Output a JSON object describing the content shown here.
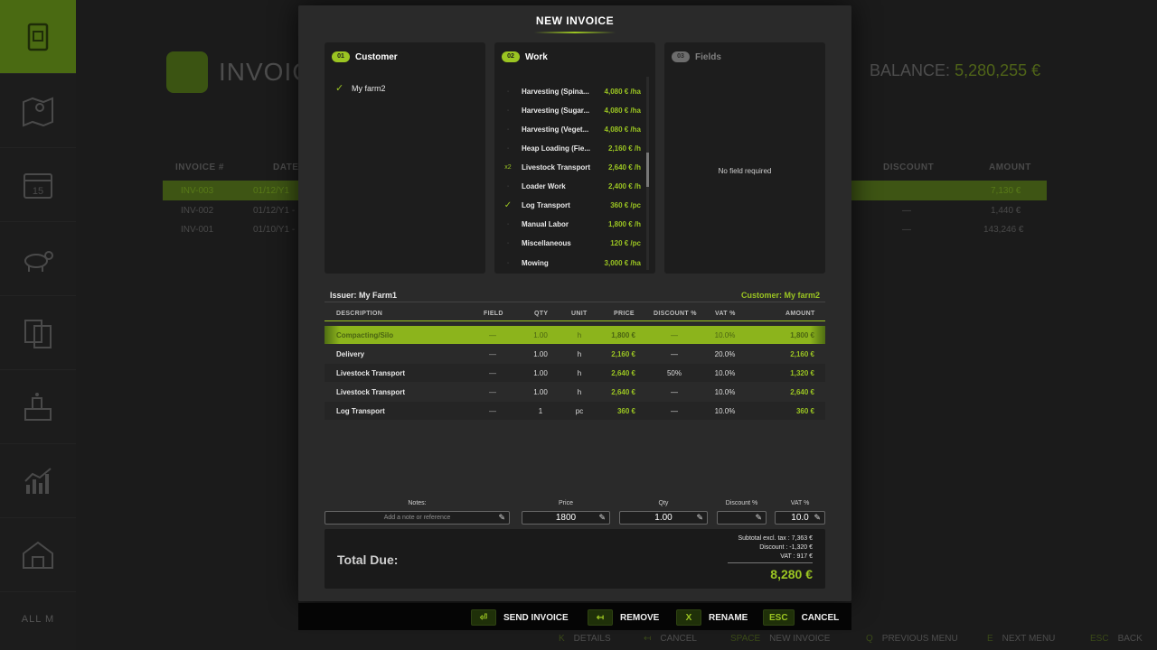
{
  "background": {
    "title": "INVOIC",
    "balance_label": "BALANCE:",
    "balance_value": "5,280,255 €",
    "columns": [
      "INVOICE #",
      "DATE",
      "DISCOUNT",
      "AMOUNT"
    ],
    "rows": [
      {
        "id": "INV-003",
        "date": "01/12/Y1",
        "discount": "",
        "amount": "7,130 €"
      },
      {
        "id": "INV-002",
        "date": "01/12/Y1 -",
        "discount": "—",
        "amount": "1,440 €"
      },
      {
        "id": "INV-001",
        "date": "01/10/Y1 -",
        "discount": "—",
        "amount": "143,246 €"
      }
    ]
  },
  "sidebar": {
    "items": [
      "invoice-icon",
      "map-icon",
      "calendar-icon",
      "animals-icon",
      "documents-icon",
      "production-icon",
      "statistics-icon",
      "farm-icon"
    ],
    "calendar_day": "15",
    "footer": "ALL M"
  },
  "modal": {
    "title": "NEW INVOICE",
    "panels": {
      "customer": {
        "step": "01",
        "title": "Customer",
        "items": [
          "My farm2"
        ]
      },
      "work": {
        "step": "02",
        "title": "Work",
        "items": [
          {
            "marker": "·",
            "name": "Harvesting (Spina...",
            "price": "4,080 € /ha"
          },
          {
            "marker": "·",
            "name": "Harvesting (Sugar...",
            "price": "4,080 € /ha"
          },
          {
            "marker": "·",
            "name": "Harvesting (Veget...",
            "price": "4,080 € /ha"
          },
          {
            "marker": "·",
            "name": "Heap Loading (Fie...",
            "price": "2,160 € /h"
          },
          {
            "marker": "x2",
            "name": "Livestock Transport",
            "price": "2,640 € /h"
          },
          {
            "marker": "·",
            "name": "Loader Work",
            "price": "2,400 € /h"
          },
          {
            "marker": "✓",
            "name": "Log Transport",
            "price": "360 € /pc"
          },
          {
            "marker": "·",
            "name": "Manual Labor",
            "price": "1,800 € /h"
          },
          {
            "marker": "·",
            "name": "Miscellaneous",
            "price": "120 € /pc"
          },
          {
            "marker": "·",
            "name": "Mowing",
            "price": "3,000 € /ha"
          }
        ]
      },
      "fields": {
        "step": "03",
        "title": "Fields",
        "empty_text": "No field required"
      }
    },
    "issuer": "Issuer: My Farm1",
    "customer": "Customer: My farm2",
    "table": {
      "headers": {
        "description": "DESCRIPTION",
        "field": "FIELD",
        "qty": "QTY",
        "unit": "UNIT",
        "price": "PRICE",
        "discount": "DISCOUNT %",
        "vat": "VAT %",
        "amount": "AMOUNT"
      },
      "rows": [
        {
          "description": "Compacting/Silo",
          "field": "—",
          "qty": "1.00",
          "unit": "h",
          "price": "1,800 €",
          "discount": "—",
          "vat": "10.0%",
          "amount": "1,800 €"
        },
        {
          "description": "Delivery",
          "field": "—",
          "qty": "1.00",
          "unit": "h",
          "price": "2,160 €",
          "discount": "—",
          "vat": "20.0%",
          "amount": "2,160 €"
        },
        {
          "description": "Livestock Transport",
          "field": "—",
          "qty": "1.00",
          "unit": "h",
          "price": "2,640 €",
          "discount": "50%",
          "vat": "10.0%",
          "amount": "1,320 €"
        },
        {
          "description": "Livestock Transport",
          "field": "—",
          "qty": "1.00",
          "unit": "h",
          "price": "2,640 €",
          "discount": "—",
          "vat": "10.0%",
          "amount": "2,640 €"
        },
        {
          "description": "Log Transport",
          "field": "—",
          "qty": "1",
          "unit": "pc",
          "price": "360 €",
          "discount": "—",
          "vat": "10.0%",
          "amount": "360 €"
        }
      ]
    },
    "inputs": {
      "notes_label": "Notes:",
      "notes_placeholder": "Add a note or reference",
      "price_label": "Price",
      "price_value": "1800",
      "qty_label": "Qty",
      "qty_value": "1.00",
      "discount_label": "Discount %",
      "discount_value": "",
      "vat_label": "VAT %",
      "vat_value": "10.0"
    },
    "totals": {
      "label": "Total Due:",
      "subtotal": "Subtotal excl. tax : 7,363 €",
      "discount": "Discount : -1,320 €",
      "vat": "VAT : 917 €",
      "total": "8,280 €"
    }
  },
  "actions": [
    {
      "key": "⏎",
      "label": "SEND INVOICE"
    },
    {
      "key": "↤",
      "label": "REMOVE"
    },
    {
      "key": "X",
      "label": "RENAME"
    },
    {
      "key": "ESC",
      "label": "CANCEL"
    }
  ],
  "hints": [
    {
      "key": "K",
      "label": "DETAILS"
    },
    {
      "key": "↤",
      "label": "CANCEL"
    },
    {
      "key": "SPACE",
      "label": "NEW INVOICE"
    },
    {
      "key": "Q",
      "label": "PREVIOUS MENU"
    },
    {
      "key": "E",
      "label": "NEXT MENU"
    },
    {
      "key": "ESC",
      "label": "BACK"
    }
  ],
  "colors": {
    "accent": "#9bc522",
    "modal_bg": "#2a2a2a",
    "panel_bg": "#1d1d1d"
  }
}
